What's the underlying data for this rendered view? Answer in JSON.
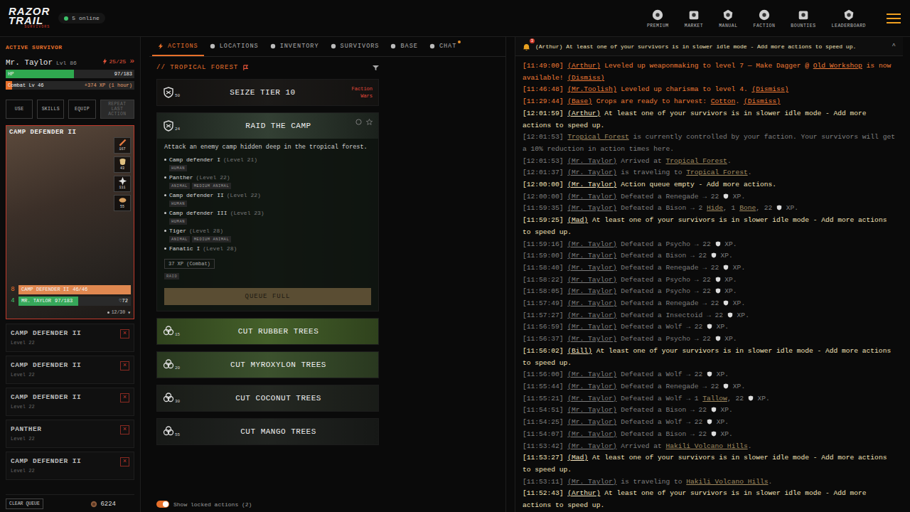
{
  "topbar": {
    "logo": [
      "RAZOR",
      "TRAIL"
    ],
    "logo_sub": "SURVIVORS",
    "online": "5 online",
    "nav": [
      {
        "label": "PREMIUM"
      },
      {
        "label": "MARKET"
      },
      {
        "label": "MANUAL"
      },
      {
        "label": "FACTION"
      },
      {
        "label": "BOUNTIES"
      },
      {
        "label": "LEADERBOARD"
      }
    ]
  },
  "sidebar": {
    "heading": "ACTIVE SURVIVOR",
    "name": "Mr. Taylor",
    "level": "Lvl 86",
    "energy": "25/25",
    "energy_arrow": "»",
    "hp": {
      "label": "HP",
      "value": "97/183",
      "level": 0.53
    },
    "skill": {
      "label": "Combat Lv 46",
      "xp_rate": "+374 XP (1 hour)",
      "level": 0.05
    },
    "buttons": [
      {
        "label": "USE",
        "disabled": false
      },
      {
        "label": "SKILLS",
        "disabled": false
      },
      {
        "label": "EQUIP",
        "disabled": false
      },
      {
        "label": "REPEAT LAST ACTION",
        "disabled": true
      }
    ],
    "combat": {
      "title": "CAMP DEFENDER II",
      "items": [
        "167",
        "43",
        "111",
        "55"
      ],
      "enemy": {
        "count": "8",
        "name": "CAMP DEFENDER II",
        "hp": "46/46",
        "level": 1
      },
      "player": {
        "count": "4",
        "name": "MR. TAYLOR",
        "hp": "97/183",
        "level": 0.53,
        "armor": "♡72"
      },
      "round": "12/30",
      "round_caret": "▾"
    },
    "queue": [
      {
        "name": "CAMP DEFENDER II",
        "level": "Level 22"
      },
      {
        "name": "CAMP DEFENDER II",
        "level": "Level 22"
      },
      {
        "name": "CAMP DEFENDER II",
        "level": "Level 22"
      },
      {
        "name": "PANTHER",
        "level": "Level 22"
      },
      {
        "name": "CAMP DEFENDER II",
        "level": "Level 22"
      }
    ],
    "queue_remove": "×",
    "clear_queue": "CLEAR QUEUE",
    "coins": "6224"
  },
  "tabs": [
    {
      "label": "ACTIONS",
      "selected": true,
      "unread": false
    },
    {
      "label": "LOCATIONS",
      "selected": false,
      "unread": false
    },
    {
      "label": "INVENTORY",
      "selected": false,
      "unread": false
    },
    {
      "label": "SURVIVORS",
      "selected": false,
      "unread": false
    },
    {
      "label": "BASE",
      "selected": false,
      "unread": false
    },
    {
      "label": "CHAT",
      "selected": false,
      "unread": true
    }
  ],
  "location": "// TROPICAL FOREST",
  "actions": [
    {
      "title": "SEIZE TIER 10",
      "kind": "combat",
      "level": "50",
      "note": "Faction Wars",
      "expanded": false,
      "color": "#1d1b19"
    },
    {
      "title": "RAID THE CAMP",
      "kind": "combat",
      "level": "24",
      "expanded": true,
      "favorite": false,
      "color": "#26302a",
      "description": "Attack an enemy camp hidden deep in the tropical forest.",
      "enemies": [
        {
          "name": "Camp defender I",
          "level": "(Level 21)",
          "tags": [
            "HUMAN"
          ]
        },
        {
          "name": "Panther",
          "level": "(Level 22)",
          "tags": [
            "ANIMAL",
            "MEDIUM ANIMAL"
          ]
        },
        {
          "name": "Camp defender II",
          "level": "(Level 22)",
          "tags": [
            "HUMAN"
          ]
        },
        {
          "name": "Camp defender III",
          "level": "(Level 23)",
          "tags": [
            "HUMAN"
          ]
        },
        {
          "name": "Tiger",
          "level": "(Level 28)",
          "tags": [
            "ANIMAL",
            "MEDIUM ANIMAL"
          ]
        },
        {
          "name": "Fanatic I",
          "level": "(Level 28)",
          "tags": []
        }
      ],
      "xp": "37 XP (Combat)",
      "category": "RAID",
      "button": {
        "label": "QUEUE FULL",
        "disabled": true
      }
    },
    {
      "title": "CUT RUBBER TREES",
      "kind": "gather",
      "level": "15",
      "expanded": false,
      "color": "#48652c"
    },
    {
      "title": "CUT MYROXYLON TREES",
      "kind": "gather",
      "level": "20",
      "expanded": false,
      "color": "#3f5630"
    },
    {
      "title": "CUT COCONUT TREES",
      "kind": "gather",
      "level": "30",
      "expanded": false,
      "color": "#262a24"
    },
    {
      "title": "CUT MANGO TREES",
      "kind": "gather",
      "level": "55",
      "expanded": false,
      "color": "#222522"
    }
  ],
  "locked_toggle": {
    "label": "Show locked actions (2)",
    "on": true
  },
  "notification": {
    "count": "3",
    "text": "(Arthur) At least one of your survivors is in slower idle mode - Add more actions to speed up.",
    "caret": "^"
  },
  "log": [
    {
      "time": "[11:49:00]",
      "actor": "(Arthur)",
      "tone": "alert",
      "parts": [
        {
          "kind": "text",
          "text": "Leveled up weaponmaking to level 7 — Make Dagger @ "
        },
        {
          "kind": "link",
          "text": "Old Workshop"
        },
        {
          "kind": "text",
          "text": " is now available! "
        },
        {
          "kind": "link",
          "text": "(Dismiss)"
        }
      ]
    },
    {
      "time": "[11:46:48]",
      "actor": "(Mr.Toolish)",
      "tone": "alert",
      "parts": [
        {
          "kind": "text",
          "text": "Leveled up charisma to level 4. "
        },
        {
          "kind": "link",
          "text": "(Dismiss)"
        }
      ]
    },
    {
      "time": "[11:29:44]",
      "actor": "(Base)",
      "tone": "alert",
      "parts": [
        {
          "kind": "text",
          "text": "Crops are ready to harvest: "
        },
        {
          "kind": "link",
          "text": "Cotton"
        },
        {
          "kind": "text",
          "text": ". "
        },
        {
          "kind": "link",
          "text": "(Dismiss)"
        }
      ]
    },
    {
      "time": "[12:01:59]",
      "actor": "(Arthur)",
      "tone": "notice",
      "parts": [
        {
          "kind": "text",
          "text": "At least one of your survivors is in slower idle mode - Add more actions to speed up."
        }
      ]
    },
    {
      "time": "[12:01:53]",
      "actor": "",
      "tone": "muted",
      "parts": [
        {
          "kind": "link",
          "text": "Tropical Forest"
        },
        {
          "kind": "text",
          "text": " is currently controlled by your faction. Your survivors will get a 10% reduction in action times here."
        }
      ]
    },
    {
      "time": "[12:01:53]",
      "actor": "(Mr. Taylor)",
      "tone": "muted",
      "parts": [
        {
          "kind": "text",
          "text": "Arrived at "
        },
        {
          "kind": "link",
          "text": "Tropical Forest"
        },
        {
          "kind": "text",
          "text": "."
        }
      ]
    },
    {
      "time": "[12:01:37]",
      "actor": "(Mr. Taylor)",
      "tone": "muted",
      "parts": [
        {
          "kind": "text",
          "text": "is traveling to "
        },
        {
          "kind": "link",
          "text": "Tropical Forest"
        },
        {
          "kind": "text",
          "text": "."
        }
      ]
    },
    {
      "time": "[12:00:00]",
      "actor": "(Mr. Taylor)",
      "tone": "notice",
      "parts": [
        {
          "kind": "text",
          "text": "Action queue empty - Add more actions."
        }
      ]
    },
    {
      "time": "[12:00:00]",
      "actor": "(Mr. Taylor)",
      "tone": "muted",
      "parts": [
        {
          "kind": "text",
          "text": "Defeated a Renegade → 22 "
        },
        {
          "kind": "shield"
        },
        {
          "kind": "text",
          "text": " XP."
        }
      ]
    },
    {
      "time": "[11:59:35]",
      "actor": "(Mr. Taylor)",
      "tone": "muted",
      "parts": [
        {
          "kind": "text",
          "text": "Defeated a Bison → 2 "
        },
        {
          "kind": "link",
          "text": "Hide"
        },
        {
          "kind": "text",
          "text": ", 1 "
        },
        {
          "kind": "link",
          "text": "Bone"
        },
        {
          "kind": "text",
          "text": ", 22 "
        },
        {
          "kind": "shield"
        },
        {
          "kind": "text",
          "text": " XP."
        }
      ]
    },
    {
      "time": "[11:59:25]",
      "actor": "(Mad)",
      "tone": "notice",
      "parts": [
        {
          "kind": "text",
          "text": "At least one of your survivors is in slower idle mode - Add more actions to speed up."
        }
      ]
    },
    {
      "time": "[11:59:16]",
      "actor": "(Mr. Taylor)",
      "tone": "muted",
      "parts": [
        {
          "kind": "text",
          "text": "Defeated a Psycho → 22 "
        },
        {
          "kind": "shield"
        },
        {
          "kind": "text",
          "text": " XP."
        }
      ]
    },
    {
      "time": "[11:59:00]",
      "actor": "(Mr. Taylor)",
      "tone": "muted",
      "parts": [
        {
          "kind": "text",
          "text": "Defeated a Bison → 22 "
        },
        {
          "kind": "shield"
        },
        {
          "kind": "text",
          "text": " XP."
        }
      ]
    },
    {
      "time": "[11:58:40]",
      "actor": "(Mr. Taylor)",
      "tone": "muted",
      "parts": [
        {
          "kind": "text",
          "text": "Defeated a Renegade → 22 "
        },
        {
          "kind": "shield"
        },
        {
          "kind": "text",
          "text": " XP."
        }
      ]
    },
    {
      "time": "[11:58:22]",
      "actor": "(Mr. Taylor)",
      "tone": "muted",
      "parts": [
        {
          "kind": "text",
          "text": "Defeated a Psycho → 22 "
        },
        {
          "kind": "shield"
        },
        {
          "kind": "text",
          "text": " XP."
        }
      ]
    },
    {
      "time": "[11:58:05]",
      "actor": "(Mr. Taylor)",
      "tone": "muted",
      "parts": [
        {
          "kind": "text",
          "text": "Defeated a Psycho → 22 "
        },
        {
          "kind": "shield"
        },
        {
          "kind": "text",
          "text": " XP."
        }
      ]
    },
    {
      "time": "[11:57:49]",
      "actor": "(Mr. Taylor)",
      "tone": "muted",
      "parts": [
        {
          "kind": "text",
          "text": "Defeated a Renegade → 22 "
        },
        {
          "kind": "shield"
        },
        {
          "kind": "text",
          "text": " XP."
        }
      ]
    },
    {
      "time": "[11:57:27]",
      "actor": "(Mr. Taylor)",
      "tone": "muted",
      "parts": [
        {
          "kind": "text",
          "text": "Defeated a Insectoid → 22 "
        },
        {
          "kind": "shield"
        },
        {
          "kind": "text",
          "text": " XP."
        }
      ]
    },
    {
      "time": "[11:56:59]",
      "actor": "(Mr. Taylor)",
      "tone": "muted",
      "parts": [
        {
          "kind": "text",
          "text": "Defeated a Wolf → 22 "
        },
        {
          "kind": "shield"
        },
        {
          "kind": "text",
          "text": " XP."
        }
      ]
    },
    {
      "time": "[11:56:37]",
      "actor": "(Mr. Taylor)",
      "tone": "muted",
      "parts": [
        {
          "kind": "text",
          "text": "Defeated a Psycho → 22 "
        },
        {
          "kind": "shield"
        },
        {
          "kind": "text",
          "text": " XP."
        }
      ]
    },
    {
      "time": "[11:56:02]",
      "actor": "(Bill)",
      "tone": "notice",
      "parts": [
        {
          "kind": "text",
          "text": "At least one of your survivors is in slower idle mode - Add more actions to speed up."
        }
      ]
    },
    {
      "time": "[11:56:00]",
      "actor": "(Mr. Taylor)",
      "tone": "muted",
      "parts": [
        {
          "kind": "text",
          "text": "Defeated a Wolf → 22 "
        },
        {
          "kind": "shield"
        },
        {
          "kind": "text",
          "text": " XP."
        }
      ]
    },
    {
      "time": "[11:55:44]",
      "actor": "(Mr. Taylor)",
      "tone": "muted",
      "parts": [
        {
          "kind": "text",
          "text": "Defeated a Renegade → 22 "
        },
        {
          "kind": "shield"
        },
        {
          "kind": "text",
          "text": " XP."
        }
      ]
    },
    {
      "time": "[11:55:21]",
      "actor": "(Mr. Taylor)",
      "tone": "muted",
      "parts": [
        {
          "kind": "text",
          "text": "Defeated a Wolf → 1 "
        },
        {
          "kind": "link",
          "text": "Tallow"
        },
        {
          "kind": "text",
          "text": ", 22 "
        },
        {
          "kind": "shield"
        },
        {
          "kind": "text",
          "text": " XP."
        }
      ]
    },
    {
      "time": "[11:54:51]",
      "actor": "(Mr. Taylor)",
      "tone": "muted",
      "parts": [
        {
          "kind": "text",
          "text": "Defeated a Bison → 22 "
        },
        {
          "kind": "shield"
        },
        {
          "kind": "text",
          "text": " XP."
        }
      ]
    },
    {
      "time": "[11:54:25]",
      "actor": "(Mr. Taylor)",
      "tone": "muted",
      "parts": [
        {
          "kind": "text",
          "text": "Defeated a Wolf → 22 "
        },
        {
          "kind": "shield"
        },
        {
          "kind": "text",
          "text": " XP."
        }
      ]
    },
    {
      "time": "[11:54:07]",
      "actor": "(Mr. Taylor)",
      "tone": "muted",
      "parts": [
        {
          "kind": "text",
          "text": "Defeated a Bison → 22 "
        },
        {
          "kind": "shield"
        },
        {
          "kind": "text",
          "text": " XP."
        }
      ]
    },
    {
      "time": "[11:53:42]",
      "actor": "(Mr. Taylor)",
      "tone": "muted",
      "parts": [
        {
          "kind": "text",
          "text": "Arrived at "
        },
        {
          "kind": "link",
          "text": "Hakili Volcano Hills"
        },
        {
          "kind": "text",
          "text": "."
        }
      ]
    },
    {
      "time": "[11:53:27]",
      "actor": "(Mad)",
      "tone": "notice",
      "parts": [
        {
          "kind": "text",
          "text": "At least one of your survivors is in slower idle mode - Add more actions to speed up."
        }
      ]
    },
    {
      "time": "[11:53:11]",
      "actor": "(Mr. Taylor)",
      "tone": "muted",
      "parts": [
        {
          "kind": "text",
          "text": "is traveling to "
        },
        {
          "kind": "link",
          "text": "Hakili Volcano Hills"
        },
        {
          "kind": "text",
          "text": "."
        }
      ]
    },
    {
      "time": "[11:52:43]",
      "actor": "(Arthur)",
      "tone": "notice",
      "parts": [
        {
          "kind": "text",
          "text": "At least one of your survivors is in slower idle mode - Add more actions to speed up."
        }
      ]
    }
  ]
}
